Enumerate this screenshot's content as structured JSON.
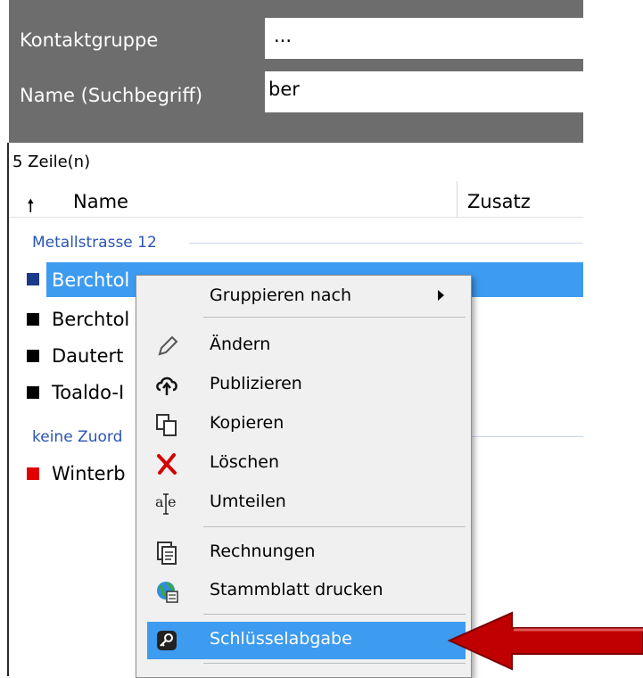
{
  "filter": {
    "contact_group_label": "Kontaktgruppe",
    "contact_group_value": "...",
    "name_label": "Name (Suchbegriff)",
    "name_value": "ber"
  },
  "list": {
    "row_count": "5 Zeile(n)",
    "columns": {
      "name": "Name",
      "extra": "Zusatz"
    },
    "groups": [
      {
        "label": "Metallstrasse 12",
        "rows": [
          "Berchtol",
          "Berchtol",
          "Dautert",
          "Toaldo-I"
        ]
      },
      {
        "label": "keine Zuord",
        "rows": [
          "Winterb"
        ]
      }
    ]
  },
  "context_menu": {
    "items": [
      {
        "label": "Gruppieren nach",
        "icon": "submenu-arrow-icon"
      },
      {
        "label": "Ändern",
        "icon": "pencil-icon"
      },
      {
        "label": "Publizieren",
        "icon": "cloud-upload-icon"
      },
      {
        "label": "Kopieren",
        "icon": "copy-icon"
      },
      {
        "label": "Löschen",
        "icon": "delete-x-icon"
      },
      {
        "label": "Umteilen",
        "icon": "text-cursor-icon"
      },
      {
        "label": "Rechnungen",
        "icon": "invoice-icon"
      },
      {
        "label": "Stammblatt drucken",
        "icon": "globe-print-icon"
      },
      {
        "label": "Schlüsselabgabe",
        "icon": "key-icon"
      }
    ]
  },
  "colors": {
    "selection": "#3d9bf0",
    "panel": "#6d6d6d",
    "group_text": "#2a55b5",
    "arrow": "#c00000",
    "status_red": "#e00000"
  }
}
